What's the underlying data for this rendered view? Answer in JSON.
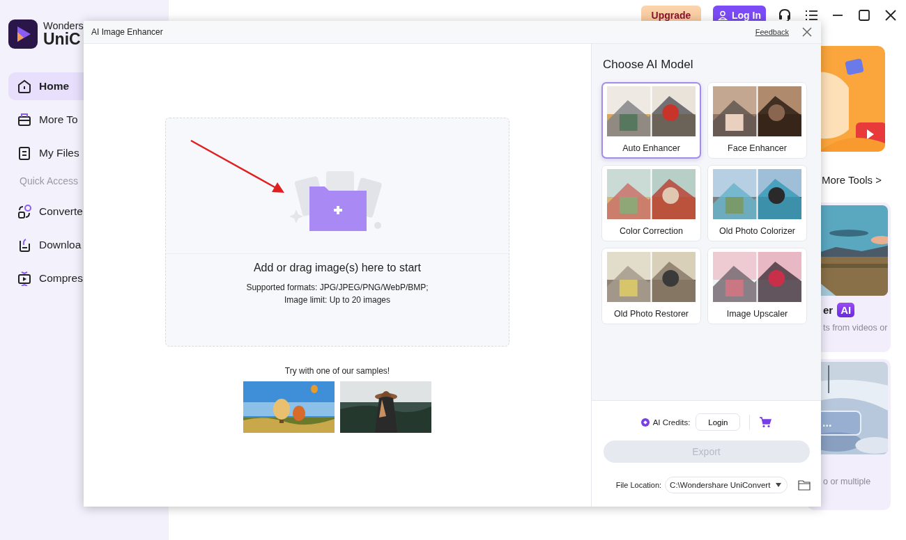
{
  "app": {
    "logo": {
      "line1": "Wonders",
      "line2": "UniC"
    },
    "nav": [
      {
        "kind": "home",
        "label": "Home",
        "selected": true
      },
      {
        "kind": "tools",
        "label": "More To",
        "selected": false
      },
      {
        "kind": "files",
        "label": "My Files",
        "selected": false
      }
    ],
    "section": "Quick Access",
    "quick": [
      {
        "kind": "convert",
        "label": "Converte"
      },
      {
        "kind": "download",
        "label": "Downloa"
      },
      {
        "kind": "compress",
        "label": "Compres"
      }
    ],
    "top_bar": {
      "upgrade": "Upgrade",
      "login": "Log In"
    },
    "more_tools": "More Tools >",
    "cards": [
      {
        "kind": "banner"
      },
      {
        "kind": "tool",
        "title": "er",
        "badge": "AI",
        "description": "ts from videos or"
      },
      {
        "kind": "tool",
        "button": "...",
        "description": "o or multiple"
      }
    ]
  },
  "dialog": {
    "title": "AI Image Enhancer",
    "feedback": "Feedback",
    "dropzone": {
      "title": "Add or drag image(s) here to start",
      "formats": "Supported formats: JPG/JPEG/PNG/WebP/BMP;",
      "limit": "Image limit: Up to 20 images"
    },
    "samples_label": "Try with one of our samples!",
    "samples": [
      {
        "kind": "balloons"
      },
      {
        "kind": "hiker"
      }
    ],
    "models_title": "Choose AI Model",
    "models": [
      {
        "label": "Auto Enhancer",
        "selected": true
      },
      {
        "label": "Face Enhancer",
        "selected": false
      },
      {
        "label": "Color Correction",
        "selected": false
      },
      {
        "label": "Old Photo Colorizer",
        "selected": false
      },
      {
        "label": "Old Photo Restorer",
        "selected": false
      },
      {
        "label": "Image Upscaler",
        "selected": false
      }
    ],
    "credits_label": "AI Credits:",
    "credits_login": "Login",
    "export": {
      "label": "Export",
      "disabled": true
    },
    "file_location": {
      "label": "File Location:",
      "value": "C:\\Wondershare UniConvert"
    }
  }
}
